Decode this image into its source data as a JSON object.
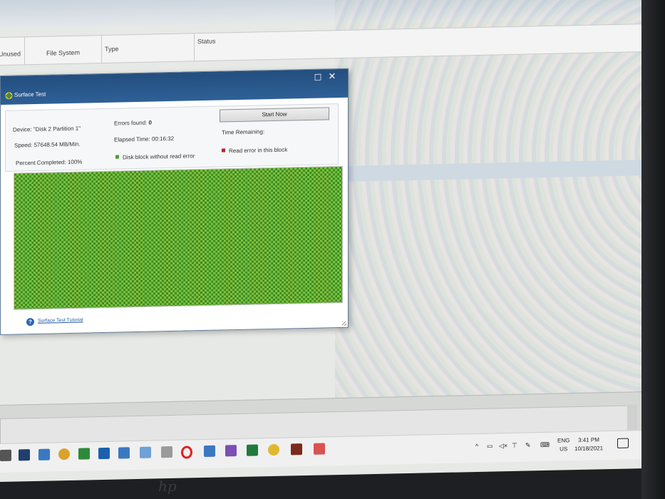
{
  "background_window": {
    "columns": [
      {
        "label": "Unused"
      },
      {
        "label": "File System"
      },
      {
        "label": "Type"
      },
      {
        "label": "Status"
      }
    ]
  },
  "dialog": {
    "title": "Surface Test",
    "device_label": "Device:",
    "device_value": "\"Disk 2 Partition 1\"",
    "speed_label": "Speed:",
    "speed_value": "57648.54 MB/Min.",
    "percent_label": "Percent Completed:",
    "percent_value": "100%",
    "errors_label": "Errors found:",
    "errors_value": "0",
    "elapsed_label": "Elapsed Time:",
    "elapsed_value": "00:16:32",
    "remaining_label": "Time Remaining:",
    "legend_ok": "Disk block without read error",
    "legend_err": "Read error in this block",
    "start_button": "Start Now",
    "help_link": "Surface Test Tutorial",
    "progress_percent": 100,
    "colors": {
      "ok_block": "#4a9e2e",
      "error_block": "#c0202a",
      "titlebar": "#2a5a8e"
    }
  },
  "taskbar": {
    "lang_top": "ENG",
    "lang_bottom": "US",
    "time": "3:41 PM",
    "date": "10/18/2021",
    "icons": [
      "windows-tool-icon",
      "security-icon",
      "app-icon",
      "controller-icon",
      "teamviewer-icon",
      "network-icon",
      "app-window-icon",
      "tools-icon",
      "opera-icon",
      "app-window-icon",
      "visual-studio-icon",
      "excel-icon",
      "partition-tool-icon",
      "winrar-icon",
      "paint-icon"
    ]
  },
  "bezel": {
    "logo": "hp"
  }
}
